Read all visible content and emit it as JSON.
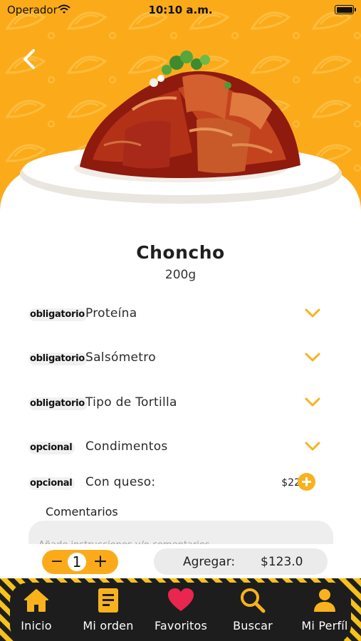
{
  "status_bar": {
    "carrier": "Operador",
    "time": "10:10 a.m."
  },
  "product": {
    "name": "Choncho",
    "weight": "200g"
  },
  "options": [
    {
      "tag": "obligatorio",
      "label": "Proteína",
      "control": "chevron-down-icon"
    },
    {
      "tag": "obligatorio",
      "label": "Salsómetro",
      "control": "chevron-down-icon"
    },
    {
      "tag": "obligatorio",
      "label": "Tipo de Tortilla",
      "control": "chevron-down-icon"
    },
    {
      "tag": "opcional",
      "label": "Condimentos",
      "control": "chevron-down-icon"
    },
    {
      "tag": "opcional",
      "label": "Con queso:",
      "price": "$22",
      "control": "plus-circle-icon"
    }
  ],
  "comments": {
    "label": "Comentarios",
    "placeholder": "Añade instrucciones y/o comentarios."
  },
  "order": {
    "quantity": "1",
    "minus_symbol": "−",
    "plus_symbol": "+",
    "add_label": "Agregar:",
    "total": "$123.0"
  },
  "tabbar": {
    "items": [
      {
        "label": "Inicio",
        "icon": "home-icon"
      },
      {
        "label": "Mi orden",
        "icon": "order-list-icon"
      },
      {
        "label": "Favoritos",
        "icon": "heart-icon"
      },
      {
        "label": "Buscar",
        "icon": "search-icon"
      },
      {
        "label": "Mi Perfíl",
        "icon": "user-icon"
      }
    ]
  },
  "colors": {
    "brand_orange": "#fbab1a",
    "accent_yellow": "#f8b21d",
    "favorite_red": "#e8264f",
    "tabbar_dark": "#1d1d1d"
  }
}
